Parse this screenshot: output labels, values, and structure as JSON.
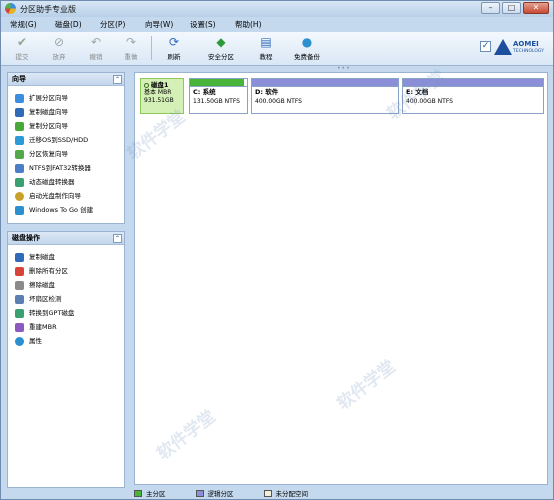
{
  "window": {
    "title": "分区助手专业版"
  },
  "window_buttons": {
    "minimize": "–",
    "maximize": "□",
    "close": "✕"
  },
  "menu": [
    "常规(G)",
    "磁盘(D)",
    "分区(P)",
    "向导(W)",
    "设置(S)",
    "帮助(H)"
  ],
  "toolbar": {
    "submit": "提交",
    "discard": "放弃",
    "undo": "撤销",
    "redo": "重做",
    "refresh": "刷新",
    "safe_partition": "安全分区",
    "tutorial": "教程",
    "free_backup": "免费备份"
  },
  "logo": {
    "brand": "AOMEI",
    "sub": "TECHNOLOGY"
  },
  "wizard_panel": {
    "title": "向导",
    "items": [
      "扩展分区向导",
      "复制磁盘向导",
      "复制分区向导",
      "迁移OS到SSD/HDD",
      "分区恢复向导",
      "NTFS到FAT32转换器",
      "动态磁盘转换器",
      "启动光盘制作向导",
      "Windows To Go 创建"
    ]
  },
  "disk_ops_panel": {
    "title": "磁盘操作",
    "items": [
      "复制磁盘",
      "删除所有分区",
      "擦除磁盘",
      "坏扇区检测",
      "转换到GPT磁盘",
      "重建MBR",
      "属性"
    ]
  },
  "disk": {
    "name": "磁盘1",
    "type": "基本 MBR",
    "size": "931.51GB"
  },
  "partitions": [
    {
      "name": "C: 系统",
      "capacity": "131.50GB NTFS",
      "used_fraction": 0.95,
      "color": "#48b43a"
    },
    {
      "name": "D: 软件",
      "capacity": "400.00GB NTFS",
      "used_fraction": 1.0,
      "color": "#8b8fd8"
    },
    {
      "name": "E: 文档",
      "capacity": "400.00GB NTFS",
      "used_fraction": 1.0,
      "color": "#8b8fd8"
    }
  ],
  "legend": {
    "primary": "主分区",
    "logical": "逻辑分区",
    "unallocated": "未分配空间"
  },
  "colors": {
    "primary": "#48b43a",
    "logical": "#8b8fd8",
    "unallocated": "#f2efdc",
    "disk_bg": "#d4f0b6"
  }
}
